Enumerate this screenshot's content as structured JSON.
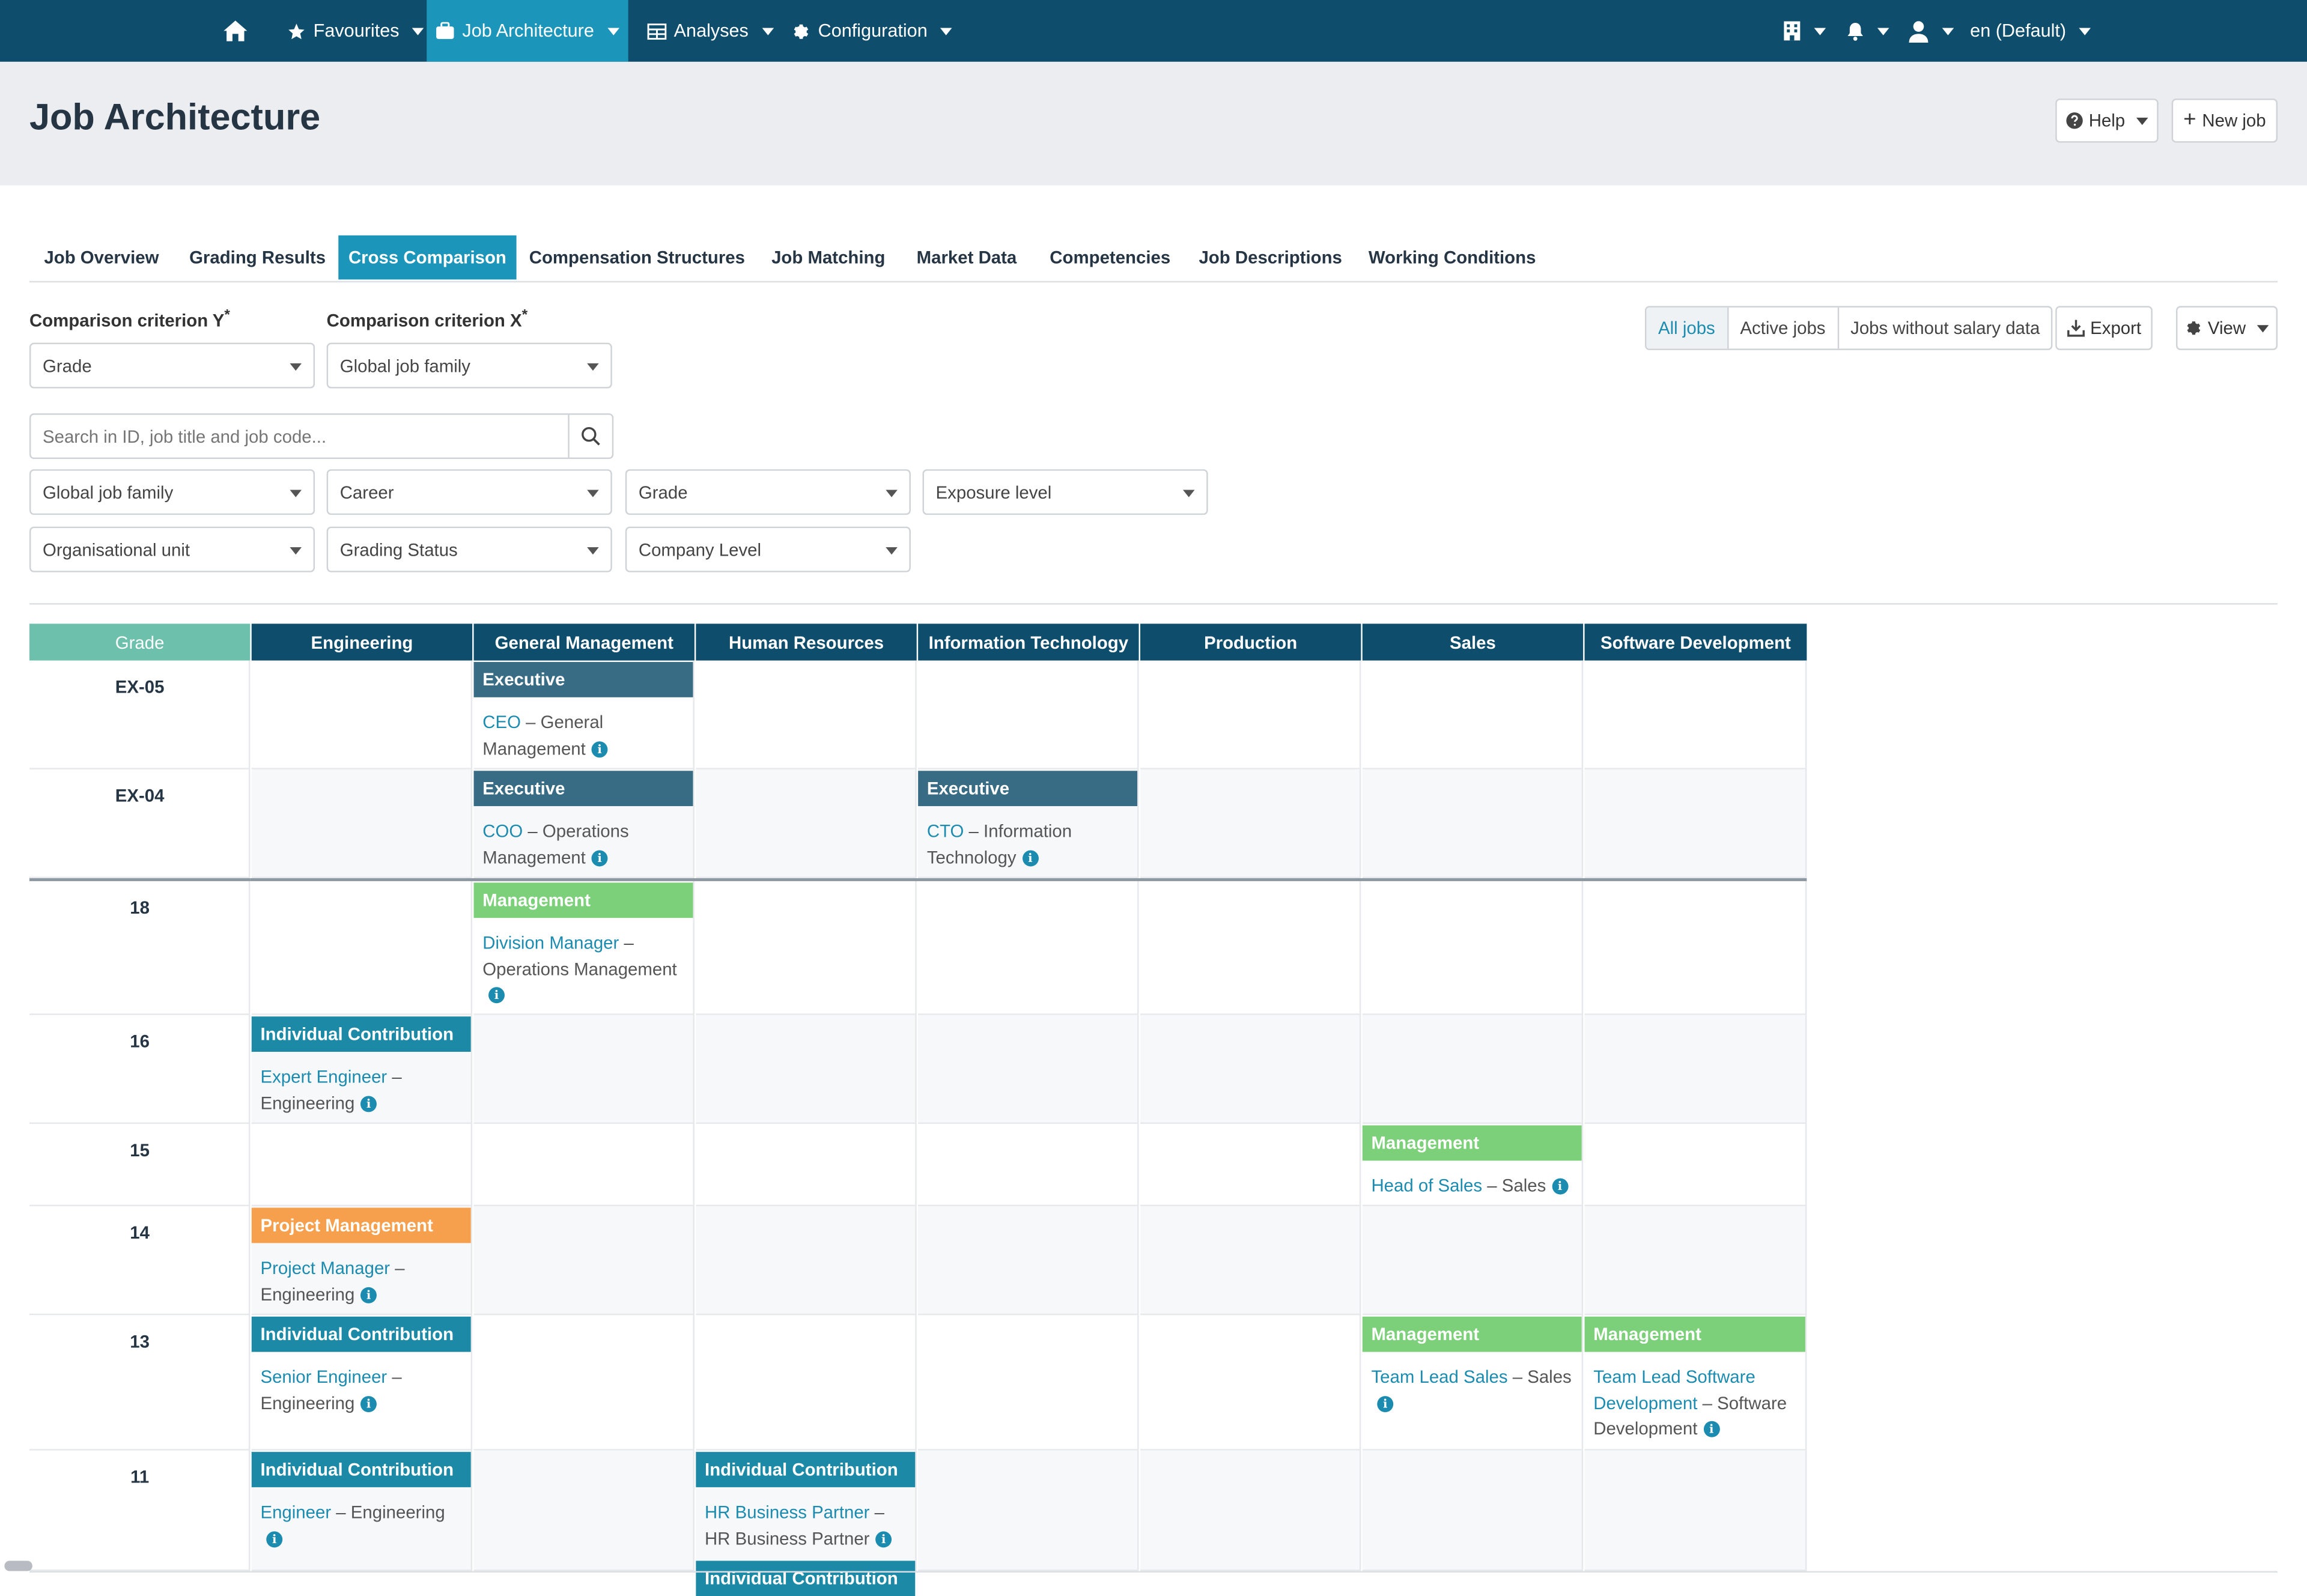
{
  "nav": {
    "favourites": "Favourites",
    "job_architecture": "Job Architecture",
    "analyses": "Analyses",
    "configuration": "Configuration",
    "language": "en (Default)"
  },
  "header": {
    "title": "Job Architecture",
    "help": "Help",
    "new_job": "New job"
  },
  "tabs": [
    "Job Overview",
    "Grading Results",
    "Cross Comparison",
    "Compensation Structures",
    "Job Matching",
    "Market Data",
    "Competencies",
    "Job Descriptions",
    "Working Conditions"
  ],
  "criteria": {
    "y_label": "Comparison criterion Y",
    "x_label": "Comparison criterion X",
    "required_mark": "*",
    "y_value": "Grade",
    "x_value": "Global job family"
  },
  "search": {
    "placeholder": "Search in ID, job title and job code..."
  },
  "filters": [
    "Global job family",
    "Career",
    "Grade",
    "Exposure level",
    "Organisational unit",
    "Grading Status",
    "Company Level"
  ],
  "job_filter": [
    "All jobs",
    "Active jobs",
    "Jobs without salary data"
  ],
  "actions": {
    "export": "Export",
    "view": "View"
  },
  "matrix": {
    "grade_header": "Grade",
    "columns": [
      "Engineering",
      "General Management",
      "Human Resources",
      "Information Technology",
      "Production",
      "Sales",
      "Software Development"
    ],
    "rows": [
      "EX-05",
      "EX-04",
      "18",
      "16",
      "15",
      "14",
      "13",
      "11"
    ],
    "cells": [
      {
        "band": "Executive",
        "title": "CEO",
        "sep": " – ",
        "family": "General Management"
      },
      {
        "band": "Executive",
        "title": "COO",
        "sep": " – ",
        "family": "Operations Management"
      },
      {
        "band": "Executive",
        "title": "CTO",
        "sep": " – ",
        "family": "Information Technology"
      },
      {
        "band": "Management",
        "title": "Division Manager",
        "sep": " – ",
        "family": "Operations Management"
      },
      {
        "band": "Individual Contribution",
        "title": "Expert Engineer",
        "sep": " – ",
        "family": "Engineering"
      },
      {
        "band": "Management",
        "title": "Head of Sales",
        "sep": " – ",
        "family": "Sales"
      },
      {
        "band": "Project Management",
        "title": "Project Manager",
        "sep": " – ",
        "family": "Engineering"
      },
      {
        "band": "Individual Contribution",
        "title": "Senior Engineer",
        "sep": " – ",
        "family": "Engineering"
      },
      {
        "band": "Management",
        "title": "Team Lead Sales",
        "sep": " – ",
        "family": "Sales"
      },
      {
        "band": "Management",
        "title": "Team Lead Software Development",
        "sep": " – ",
        "family": "Software Development"
      },
      {
        "band": "Individual Contribution",
        "title": "Engineer",
        "sep": " – ",
        "family": "Engineering"
      },
      {
        "band": "Individual Contribution",
        "title": "HR Business Partner",
        "sep": " – ",
        "family": "HR Business Partner"
      },
      {
        "band": "Individual Contribution"
      }
    ],
    "info_glyph": "i"
  },
  "colors": {
    "nav_bg": "#0e4d6c",
    "accent": "#1b95b9",
    "grade_header": "#6cc0ac",
    "band_executive": "#386c85",
    "band_management": "#7dd07a",
    "band_individual": "#1c8aa6",
    "band_project": "#f6a04d"
  }
}
